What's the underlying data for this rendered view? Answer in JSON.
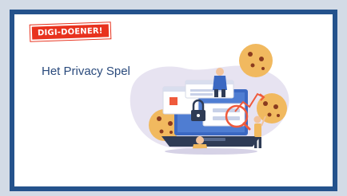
{
  "badge": {
    "text": "DIGI-DOENER!"
  },
  "card": {
    "title": "Het Privacy Spel"
  },
  "colors": {
    "frame": "#24528c",
    "badge": "#e8321e",
    "title": "#2a4a7c",
    "blob": "#e7e3f1",
    "cookie": "#f1b95f",
    "cookie_chip": "#8a3b1f",
    "screen": "#3b68c2",
    "highlight": "#ef5a3c"
  },
  "illustration": {
    "icons": [
      "cookie-icon",
      "laptop-icon",
      "lock-icon",
      "magnifier-icon",
      "person-figure",
      "chart-line-icon",
      "popup-window-icon"
    ]
  }
}
